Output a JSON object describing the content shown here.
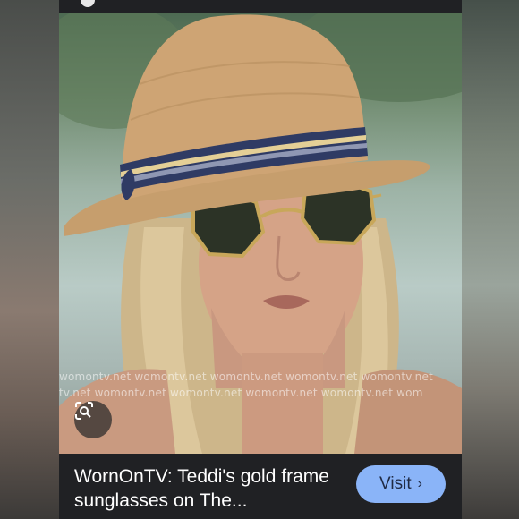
{
  "image": {
    "watermark_line_1": "womontv.net  womontv.net  womontv.net  womontv.net  womontv.net",
    "watermark_line_2": "tv.net  womontv.net  womontv.net  womontv.net  womontv.net  wom"
  },
  "lens": {
    "icon": "lens-search-icon"
  },
  "caption": {
    "title": "WornOnTV: Teddi's gold frame sunglasses on The..."
  },
  "visit_button": {
    "label": "Visit",
    "icon": "chevron-right-icon"
  },
  "colors": {
    "accent": "#8ab4f8",
    "bar": "#202124"
  }
}
